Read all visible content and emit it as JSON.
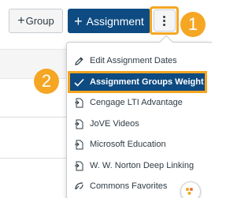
{
  "toolbar": {
    "group_button": "Group",
    "assignment_button": "Assignment"
  },
  "callouts": {
    "step1": "1",
    "step2": "2"
  },
  "menu": {
    "items": [
      {
        "label": "Edit Assignment Dates",
        "icon": "pencil-icon"
      },
      {
        "label": "Assignment Groups Weight",
        "icon": "checkmark-icon",
        "selected": true
      },
      {
        "label": "Cengage LTI Advantage",
        "icon": "external-tool-icon"
      },
      {
        "label": "JoVE Videos",
        "icon": "external-tool-icon"
      },
      {
        "label": "Microsoft Education",
        "icon": "external-tool-icon"
      },
      {
        "label": "W. W. Norton Deep Linking",
        "icon": "external-tool-icon"
      },
      {
        "label": "Commons Favorites",
        "icon": "commons-icon"
      }
    ]
  },
  "colors": {
    "primary": "#0e4b82",
    "highlight": "#f5a623",
    "text": "#2d3b45"
  }
}
